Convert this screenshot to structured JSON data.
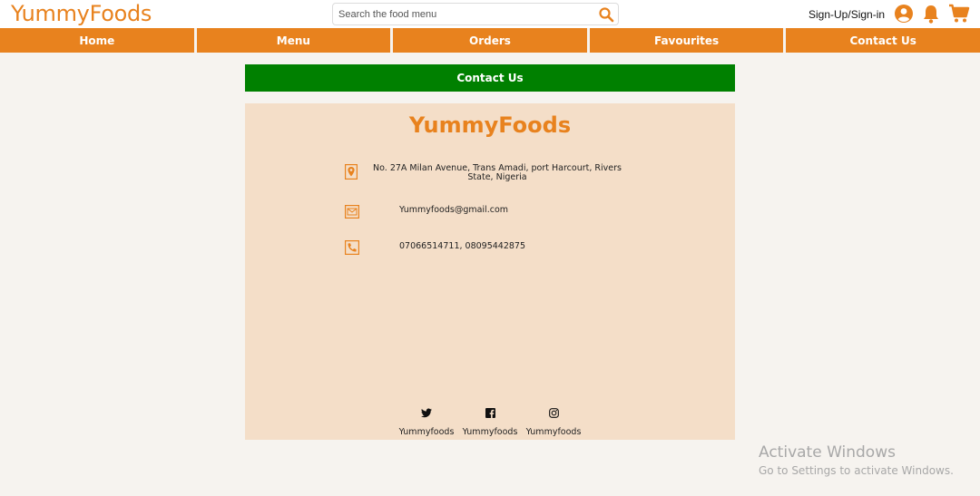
{
  "header": {
    "logo": "YummyFoods",
    "search_placeholder": "Search the food menu",
    "search_icon": "search-icon",
    "signin_label": "Sign-Up/Sign-in",
    "icons": [
      "user-circle-icon",
      "bell-icon",
      "cart-icon"
    ],
    "brand_color": "#e8821e"
  },
  "nav": {
    "items": [
      "Home",
      "Menu",
      "Orders",
      "Favourites",
      "Contact Us"
    ]
  },
  "contact": {
    "banner": "Contact Us",
    "banner_color": "#008000",
    "brand": "YummyFoods",
    "address": "No. 27A Milan Avenue, Trans Amadi, port Harcourt, Rivers State, Nigeria",
    "email": "Yummyfoods@gmail.com",
    "phone": "07066514711, 08095442875"
  },
  "social": [
    {
      "icon": "twitter-icon",
      "label": "Yummyfoods"
    },
    {
      "icon": "facebook-icon",
      "label": "Yummyfoods"
    },
    {
      "icon": "instagram-icon",
      "label": "Yummyfoods"
    }
  ],
  "watermark": {
    "title": "Activate Windows",
    "subtitle": "Go to Settings to activate Windows."
  }
}
